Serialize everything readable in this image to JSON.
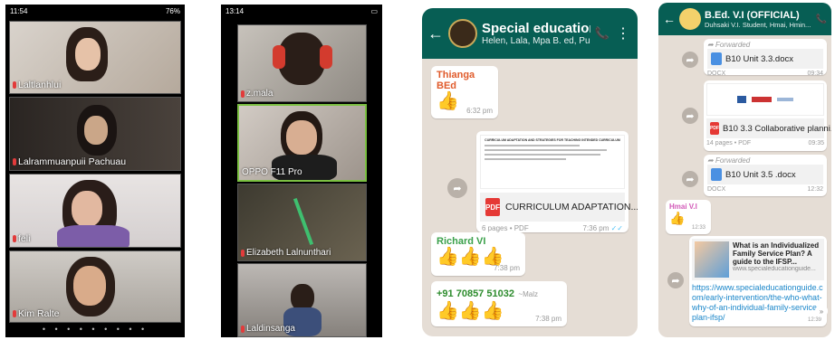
{
  "zoom_call_1": {
    "status_time": "11:54",
    "status_right": "76%",
    "participants": [
      "Laltlanhlui",
      "Lalrammuanpuii Pachuau",
      "feli",
      "Kim Ralte"
    ]
  },
  "zoom_call_2": {
    "status_time": "13:14",
    "participants": [
      "z.mala",
      "OPPO F11 Pro",
      "Elizabeth Lalnunthari",
      "Laldinsanga"
    ]
  },
  "chat_1": {
    "title": "Special education VI 2...",
    "subtitle": "Helen, Lala, Mpa B. ed, Puia VI, Ri...",
    "messages": [
      {
        "sender": "Thianga BEd",
        "time": "6:32 pm"
      },
      {
        "doc_heading": "CURRICULUM ADAPTATION AND STRATEGIES FOR TEACHING INTENDED CURRICULUM",
        "file_name": "CURRICULUM ADAPTATION...",
        "meta": "6 pages • PDF",
        "time": "7:36 pm"
      },
      {
        "sender": "Richard VI",
        "time": "7:38 pm"
      },
      {
        "sender": "+91 70857 51032",
        "sender_note": "~Malz",
        "time": "7:38 pm"
      }
    ],
    "colors": {
      "header": "#075e54",
      "sender1": "#e05a2a",
      "sender2": "#3aa04a",
      "sender3": "#2d8c2d"
    }
  },
  "chat_2": {
    "title": "B.Ed. V.I (OFFICIAL)",
    "subtitle": "Duhsaki V.I. Student, Hmai, Hmin...",
    "messages": [
      {
        "forwarded": "Forwarded",
        "file_name": "B10 Unit 3.3.docx",
        "meta": "DOCX",
        "time": "09:34"
      },
      {
        "file_name": "B10 3.3 Collaborative planni...",
        "meta": "14 pages • PDF",
        "time": "09:35"
      },
      {
        "forwarded": "Forwarded",
        "file_name": "B10 Unit 3.5 .docx",
        "meta": "DOCX",
        "time": "12:32"
      },
      {
        "sender": "Hmai V.I",
        "time": "12:33"
      },
      {
        "link_title": "What is an Individualized Family Service Plan? A guide to the IFSP...",
        "link_domain": "www.specialeducationguide...",
        "link_url": "https://www.specialeducationguide.com/early-intervention/the-who-what-why-of-an-individual-family-services-plan-ifsp/",
        "time": "12:39"
      }
    ]
  }
}
